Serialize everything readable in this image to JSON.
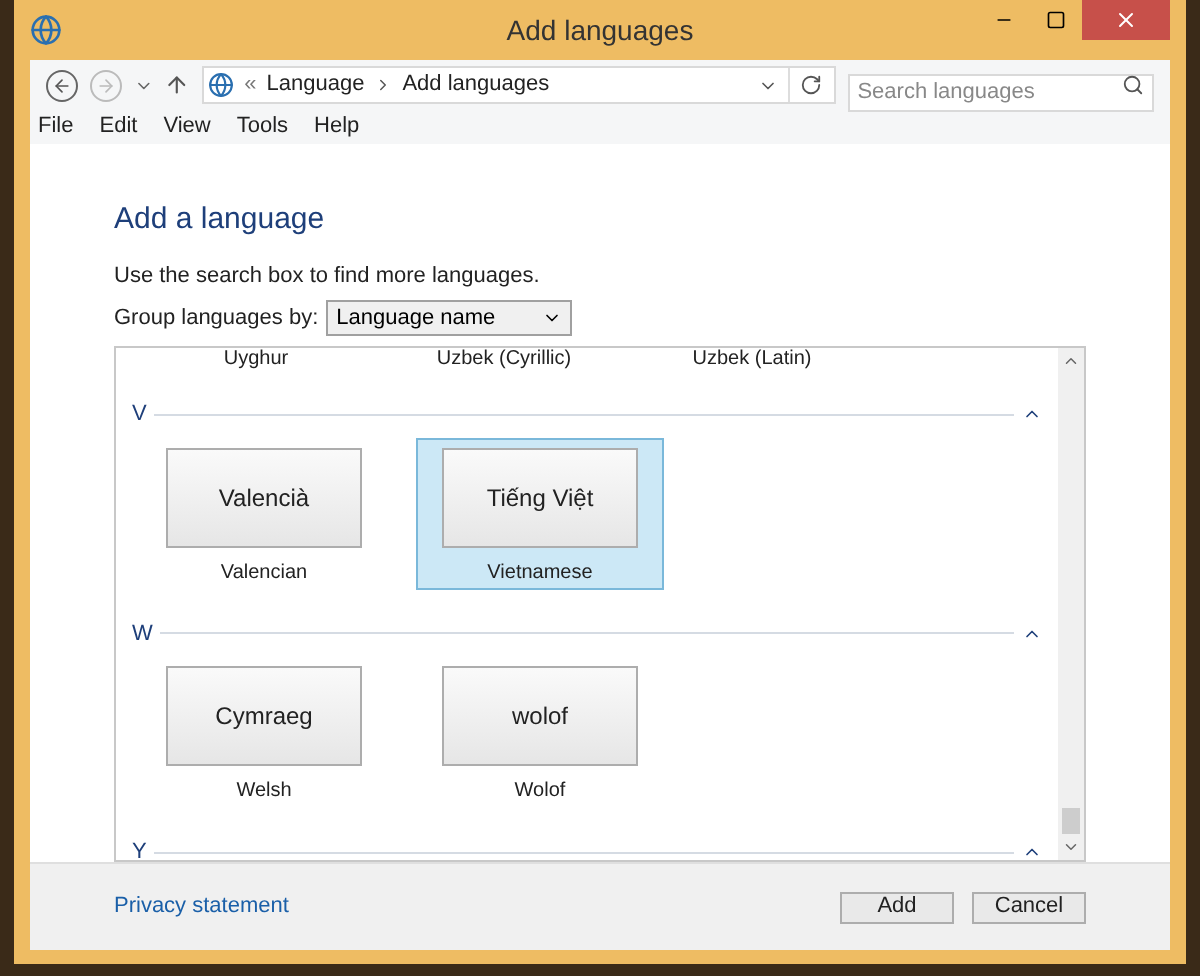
{
  "window": {
    "title": "Add languages"
  },
  "address_bar": {
    "separator": "«",
    "path": [
      "Language",
      "Add languages"
    ]
  },
  "search": {
    "placeholder": "Search languages"
  },
  "menu": [
    "File",
    "Edit",
    "View",
    "Tools",
    "Help"
  ],
  "heading": "Add a language",
  "hint": "Use the search box to find more languages.",
  "group_by": {
    "label": "Group languages by:",
    "value": "Language name"
  },
  "partial_row": [
    "Uyghur",
    "Uzbek (Cyrillic)",
    "Uzbek (Latin)"
  ],
  "groups": [
    {
      "letter": "V",
      "languages": [
        {
          "native": "Valencià",
          "name": "Valencian",
          "selected": false
        },
        {
          "native": "Tiếng Việt",
          "name": "Vietnamese",
          "selected": true
        }
      ]
    },
    {
      "letter": "W",
      "languages": [
        {
          "native": "Cymraeg",
          "name": "Welsh",
          "selected": false
        },
        {
          "native": "wolof",
          "name": "Wolof",
          "selected": false
        }
      ]
    },
    {
      "letter": "Y"
    }
  ],
  "footer": {
    "link": "Privacy statement",
    "buttons": [
      "Add",
      "Cancel"
    ]
  }
}
